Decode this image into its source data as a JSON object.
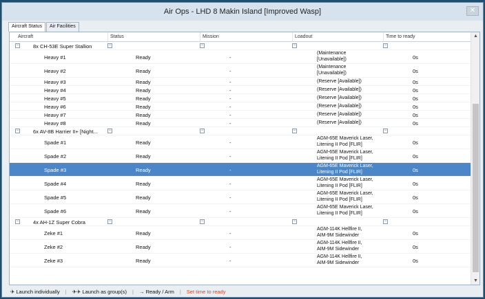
{
  "window": {
    "title": "Air Ops - LHD 8 Makin Island [Improved Wasp]"
  },
  "tabs": [
    {
      "label": "Aircraft Status"
    },
    {
      "label": "Air Facilities"
    }
  ],
  "columns": {
    "aircraft": "Aircraft",
    "status": "Status",
    "mission": "Mission",
    "loadout": "Loadout",
    "time": "Time to ready"
  },
  "groups": [
    {
      "label": "8x CH-53E Super Stallion",
      "rows": [
        {
          "name": "Heavy #1",
          "status": "Ready",
          "mission": "-",
          "loadout": [
            "(Maintenance",
            "[Unavailable])"
          ],
          "time": "0s"
        },
        {
          "name": "Heavy #2",
          "status": "Ready",
          "mission": "-",
          "loadout": [
            "(Maintenance",
            "[Unavailable])"
          ],
          "time": "0s"
        },
        {
          "name": "Heavy #3",
          "status": "Ready",
          "mission": "-",
          "loadout": [
            "(Reserve [Available])"
          ],
          "time": "0s"
        },
        {
          "name": "Heavy #4",
          "status": "Ready",
          "mission": "-",
          "loadout": [
            "(Reserve [Available])"
          ],
          "time": "0s"
        },
        {
          "name": "Heavy #5",
          "status": "Ready",
          "mission": "-",
          "loadout": [
            "(Reserve [Available])"
          ],
          "time": "0s"
        },
        {
          "name": "Heavy #6",
          "status": "Ready",
          "mission": "-",
          "loadout": [
            "(Reserve [Available])"
          ],
          "time": "0s"
        },
        {
          "name": "Heavy #7",
          "status": "Ready",
          "mission": "-",
          "loadout": [
            "(Reserve [Available])"
          ],
          "time": "0s"
        },
        {
          "name": "Heavy #8",
          "status": "Ready",
          "mission": "-",
          "loadout": [
            "(Reserve [Available])"
          ],
          "time": "0s"
        }
      ]
    },
    {
      "label": "6x AV-8B Harrier II+ [Night...",
      "rows": [
        {
          "name": "Spade #1",
          "status": "Ready",
          "mission": "-",
          "loadout": [
            "AGM-65E Maverick Laser,",
            "Litening II Pod [FLIR]"
          ],
          "time": "0s"
        },
        {
          "name": "Spade #2",
          "status": "Ready",
          "mission": "-",
          "loadout": [
            "AGM-65E Maverick Laser,",
            "Litening II Pod [FLIR]"
          ],
          "time": "0s"
        },
        {
          "name": "Spade #3",
          "status": "Ready",
          "mission": "-",
          "loadout": [
            "AGM-65E Maverick Laser,",
            "Litening II Pod [FLIR]"
          ],
          "time": "0s",
          "selected": true
        },
        {
          "name": "Spade #4",
          "status": "Ready",
          "mission": "-",
          "loadout": [
            "AGM-65E Maverick Laser,",
            "Litening II Pod [FLIR]"
          ],
          "time": "0s"
        },
        {
          "name": "Spade #5",
          "status": "Ready",
          "mission": "-",
          "loadout": [
            "AGM-65E Maverick Laser,",
            "Litening II Pod [FLIR]"
          ],
          "time": "0s"
        },
        {
          "name": "Spade #6",
          "status": "Ready",
          "mission": "-",
          "loadout": [
            "AGM-65E Maverick Laser,",
            "Litening II Pod [FLIR]"
          ],
          "time": "0s"
        }
      ]
    },
    {
      "label": "4x AH-1Z Super Cobra",
      "rows": [
        {
          "name": "Zeke #1",
          "status": "Ready",
          "mission": "-",
          "loadout": [
            "AGM-114K Hellfire II,",
            "AIM-9M Sidewinder"
          ],
          "time": "0s"
        },
        {
          "name": "Zeke #2",
          "status": "Ready",
          "mission": "-",
          "loadout": [
            "AGM-114K Hellfire II,",
            "AIM-9M Sidewinder"
          ],
          "time": "0s"
        },
        {
          "name": "Zeke #3",
          "status": "Ready",
          "mission": "-",
          "loadout": [
            "AGM-114K Hellfire II,",
            "AIM-9M Sidewinder"
          ],
          "time": "0s"
        }
      ]
    }
  ],
  "footer": {
    "launch_individually": "Launch individually",
    "launch_group": "Launch as group(s)",
    "ready_arm": "Ready / Arm",
    "set_time": "Set time to ready"
  },
  "colors": {
    "selected": "#4b86c8",
    "accent_red": "#d24a2a"
  }
}
